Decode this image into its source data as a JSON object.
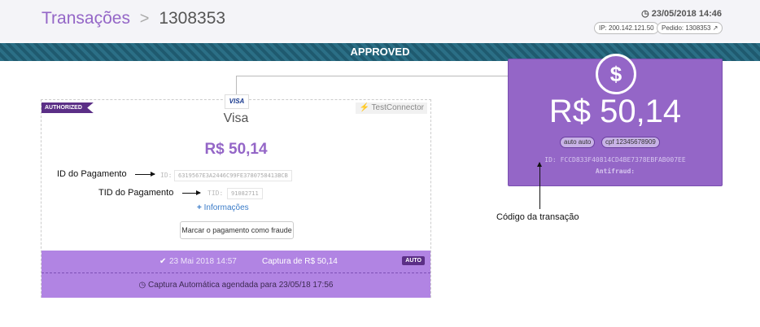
{
  "header": {
    "title": "Transações",
    "separator": ">",
    "order_id": "1308353",
    "date": "23/05/2018 14:46",
    "ip_label": "IP: 200.142.121.50",
    "order_label": "Pedido: 1308353"
  },
  "banner": {
    "status": "APPROVED"
  },
  "payment_card": {
    "badge": "AUTHORIZED",
    "connector": "TestConnector",
    "logo_text": "VISA",
    "brand": "Visa",
    "amount": "R$ 50,14",
    "id_label": "ID:",
    "id_value": "6319567E3A2446C99FE3780758413BCB",
    "tid_label": "TID:",
    "tid_value": "91082711",
    "info_link": "Informações",
    "fraud_button": "Marcar o pagamento como fraude",
    "capture": {
      "date": "23 Mai 2018 14:57",
      "text": "Captura de R$ 50,14",
      "badge": "AUTO"
    },
    "scheduled": "Captura Automática agendada para 23/05/18 17:56"
  },
  "transaction": {
    "amount": "R$ 50,14",
    "pill_auto": "auto auto",
    "pill_cpf": "cpf 12345678909",
    "id_line": "ID: FCCD833F40814CD4BE7378EBFAB007EE",
    "antifraud": "Antifraud:"
  },
  "annotations": {
    "id_pagamento": "ID do Pagamento",
    "tid_pagamento": "TID do Pagamento",
    "codigo_transacao": "Código da transação"
  },
  "colors": {
    "accent": "#9466c7",
    "banner": "#2b6f86",
    "capture_bar": "#b184e3",
    "dark_purple": "#5b2f86"
  },
  "icons": {
    "clock": "clock-icon",
    "external_link": "external-link-icon",
    "plug": "plug-icon",
    "plus": "plus-icon",
    "check": "check-icon",
    "dollar": "dollar-icon"
  }
}
